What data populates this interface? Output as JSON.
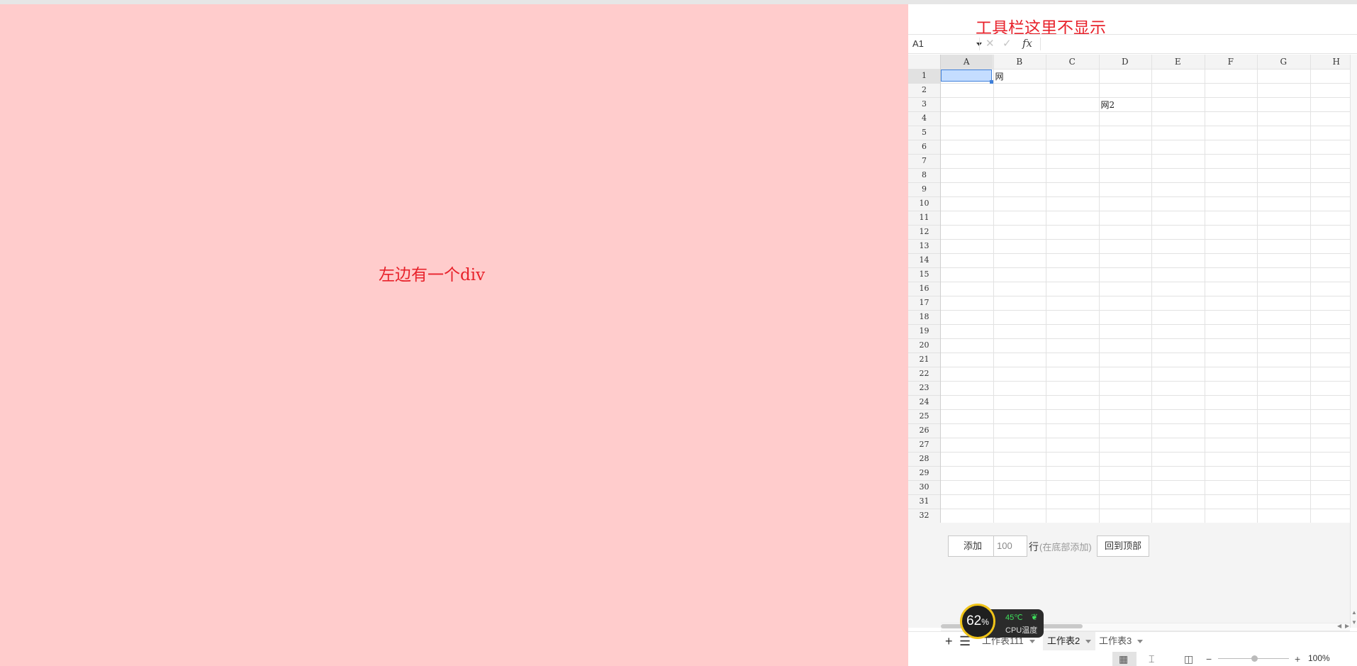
{
  "left_panel": {
    "caption": "左边有一个div"
  },
  "sheet": {
    "toolbar_note": "工具栏这里不显示",
    "formula_bar": {
      "name_box": "A1",
      "cancel_icon": "✕",
      "confirm_icon": "✓",
      "fx_label": "fx"
    },
    "columns": [
      "A",
      "B",
      "C",
      "D",
      "E",
      "F",
      "G",
      "H"
    ],
    "rows": [
      "1",
      "2",
      "3",
      "4",
      "5",
      "6",
      "7",
      "8",
      "9",
      "10",
      "11",
      "12",
      "13",
      "14",
      "15",
      "16",
      "17",
      "18",
      "19",
      "20",
      "21",
      "22",
      "23",
      "24",
      "25",
      "26",
      "27",
      "28",
      "29",
      "30",
      "31",
      "32"
    ],
    "selected_cell": "A1",
    "cells": [
      {
        "ref": "B1",
        "text": "网"
      },
      {
        "ref": "D3",
        "text": "网2"
      }
    ],
    "controls": {
      "add_button": "添加",
      "rows_input_value": "100",
      "rows_unit": "行",
      "rows_hint": "(在底部添加)",
      "back_to_top_button": "回到顶部"
    },
    "tabs": [
      {
        "label": "工作表111",
        "active": false
      },
      {
        "label": "工作表2",
        "active": true
      },
      {
        "label": "工作表3",
        "active": false
      }
    ],
    "status_bar": {
      "zoom": "100%"
    }
  },
  "overlay_widget": {
    "cpu_usage": "62",
    "cpu_unit": "%",
    "temperature": "45℃",
    "label": "CPU温度"
  },
  "colors": {
    "left_bg": "#ffcccc",
    "annotation_red": "#e8222b",
    "selection_blue": "#c4ddff",
    "selection_border": "#3f7fd9"
  }
}
